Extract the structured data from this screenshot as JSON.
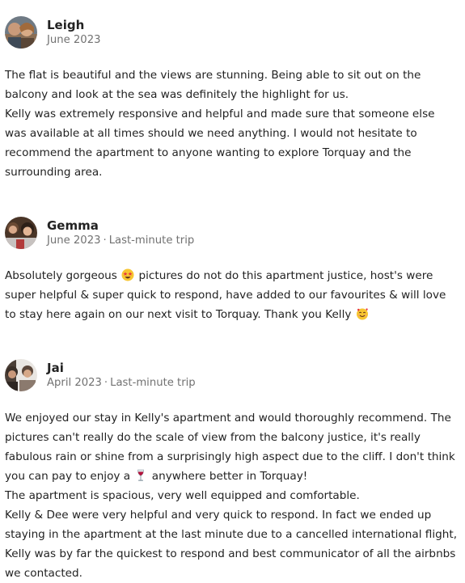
{
  "reviews": [
    {
      "name": "Leigh",
      "date": "June 2023",
      "trip": "",
      "paragraphs": [
        "The flat is beautiful and the views are stunning. Being able to sit out on the balcony and look at the sea was definitely the highlight for us.",
        "Kelly was extremely responsive and helpful and made sure that someone else was available at all times should we need anything. I would not hesitate to recommend the apartment to anyone wanting to explore Torquay and the surrounding area."
      ]
    },
    {
      "name": "Gemma",
      "date": "June 2023",
      "separator": "·",
      "trip": "Last-minute trip",
      "text_1": "Absolutely gorgeous",
      "emoji_1": "star-struck-emoji",
      "text_2": "pictures do not do this apartment justice, host's were super helpful & super quick to respond, have added to our favourites & will love to stay here again on our next visit to Torquay. Thank you Kelly",
      "emoji_2": "smiling-face-with-hearts-emoji"
    },
    {
      "name": "Jai",
      "date": "April 2023",
      "separator": "·",
      "trip": "Last-minute trip",
      "text_1": "We enjoyed our stay in Kelly's apartment and would thoroughly recommend. The pictures can't really do the scale of view from the balcony justice, it's really fabulous rain or shine from a surprisingly high aspect due to the cliff. I don't think you can pay to enjoy a",
      "emoji_1": "wine-glass-emoji",
      "text_2": "anywhere better in Torquay!",
      "paragraph_2": "The apartment is spacious, very well equipped and comfortable.",
      "paragraph_3": "Kelly & Dee were very helpful and very quick to respond. In fact we ended up staying in the apartment at the last minute due to a cancelled international flight, Kelly was by far the quickest to respond and best communicator of all the airbnbs we contacted."
    }
  ],
  "colors": {
    "text": "#222222",
    "muted": "#717171"
  }
}
